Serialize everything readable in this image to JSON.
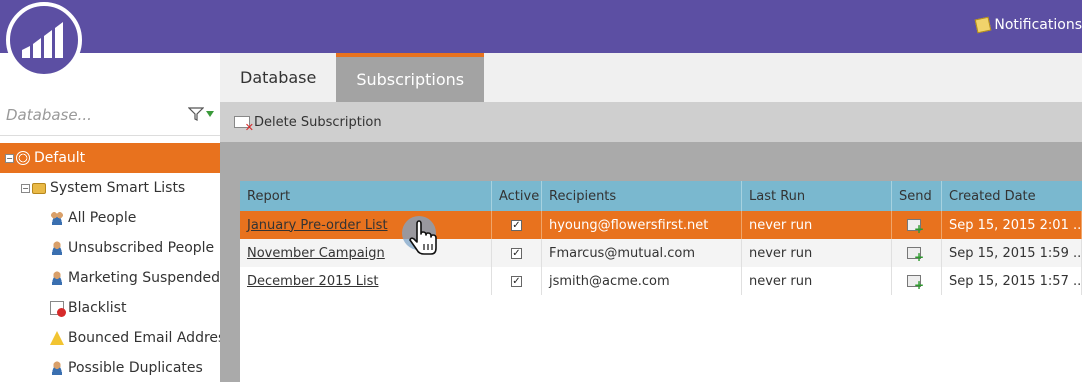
{
  "topbar": {
    "notifications_label": "Notifications"
  },
  "sidebar": {
    "search_placeholder": "Database...",
    "tree": [
      {
        "label": "Default",
        "icon": "globe-icon",
        "selected": true
      },
      {
        "label": "System Smart Lists",
        "icon": "folder-icon"
      },
      {
        "label": "All People",
        "icon": "people-group-icon"
      },
      {
        "label": "Unsubscribed People",
        "icon": "person-icon"
      },
      {
        "label": "Marketing Suspended",
        "icon": "person-icon"
      },
      {
        "label": "Blacklist",
        "icon": "blacklist-icon"
      },
      {
        "label": "Bounced Email Address",
        "icon": "warning-icon"
      },
      {
        "label": "Possible Duplicates",
        "icon": "person-add-icon"
      }
    ]
  },
  "tabs": [
    {
      "label": "Database",
      "active": false
    },
    {
      "label": "Subscriptions",
      "active": true
    }
  ],
  "toolbar": {
    "delete_label": "Delete Subscription"
  },
  "grid": {
    "columns": [
      "Report",
      "Active",
      "Recipients",
      "Last Run",
      "Send",
      "Created Date"
    ],
    "rows": [
      {
        "report": "January Pre-order List",
        "active": true,
        "recipients": "hyoung@flowersfirst.net",
        "last_run": "never run",
        "created": "Sep 15, 2015 2:01 ...",
        "selected": true
      },
      {
        "report": "November Campaign",
        "active": true,
        "recipients": "Fmarcus@mutual.com",
        "last_run": "never run",
        "created": "Sep 15, 2015 1:59 ..."
      },
      {
        "report": "December 2015 List",
        "active": true,
        "recipients": "jsmith@acme.com",
        "last_run": "never run",
        "created": "Sep 15, 2015 1:57 ..."
      }
    ]
  },
  "colors": {
    "brand_purple": "#5c4fa3",
    "accent_orange": "#e8721e",
    "grid_header": "#7ab8cf"
  }
}
